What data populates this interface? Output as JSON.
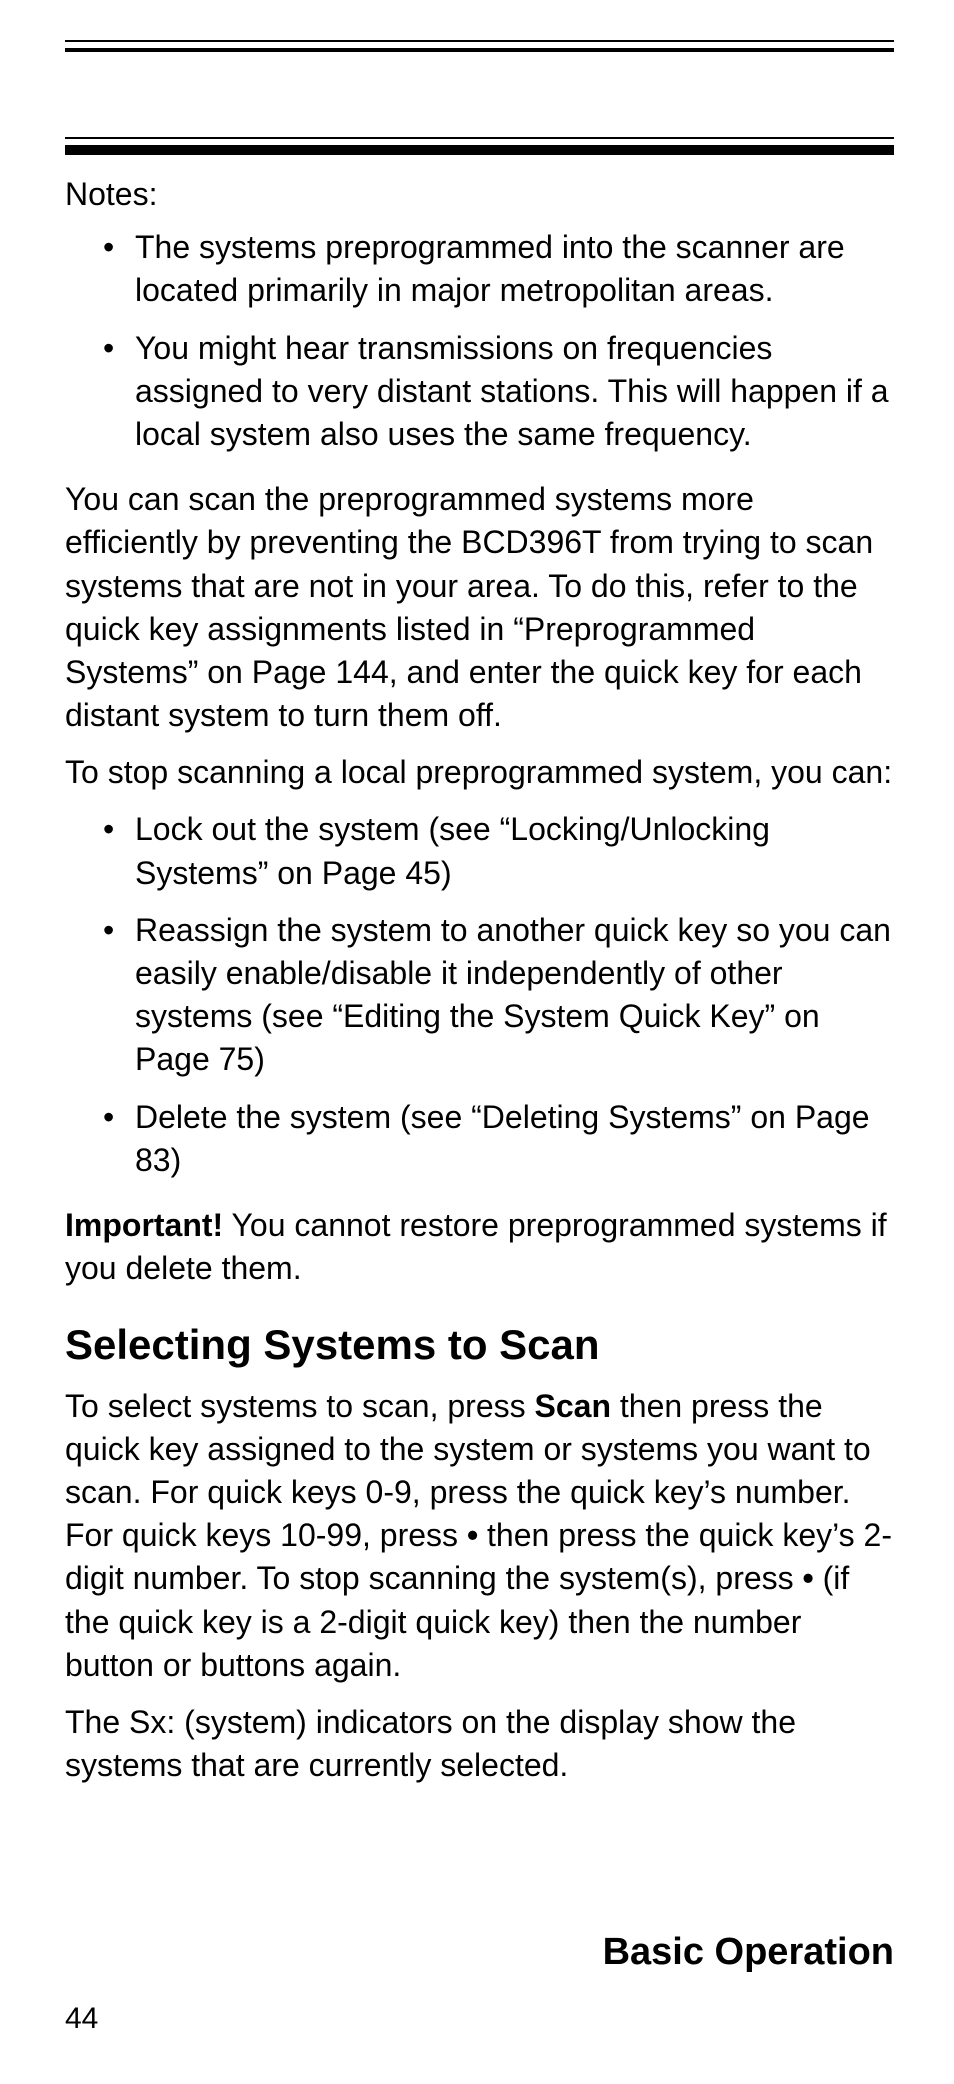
{
  "notesLabel": "Notes:",
  "notes": [
    "The systems preprogrammed into the scanner are located primarily in major metropolitan areas.",
    "You might hear transmissions on frequencies assigned to very distant stations. This will happen if a local system also uses the same frequency."
  ],
  "para1": "You can scan the preprogrammed systems more efficiently by preventing the BCD396T from trying to scan systems that are not in your area. To do this, refer to the quick key assignments listed in  “Preprogrammed Systems” on Page 144, and enter the quick key for each distant system to turn them off.",
  "para2": "To stop scanning a local preprogrammed system, you can:",
  "options": [
    "Lock out the system (see “Locking/Unlocking Systems” on Page 45)",
    "Reassign the system to another quick key so you can easily enable/disable it independently of other systems (see “Editing the System Quick Key” on Page 75)",
    "Delete the system (see “Deleting Systems” on Page 83)"
  ],
  "importantLabel": "Important!",
  "importantText": " You cannot restore preprogrammed systems if you delete them.",
  "heading": "Selecting Systems to Scan",
  "scanPara": {
    "p1": "To select systems to scan, press ",
    "scanWord": "Scan",
    "p2": " then press the quick key assigned to the system or systems you want to scan. For quick keys 0-9, press the quick key’s number. For quick keys 10-99, press ",
    "dot1": "•",
    "p3": " then press the quick key’s 2-digit number. To stop scanning the system(s), press ",
    "dot2": "•",
    "p4": " (if the quick key is a 2-digit quick key) then the number button or buttons again."
  },
  "sxPara": "The Sx: (system) indicators on the display show the systems that are currently selected.",
  "footerTitle": "Basic Operation",
  "pageNumber": "44"
}
